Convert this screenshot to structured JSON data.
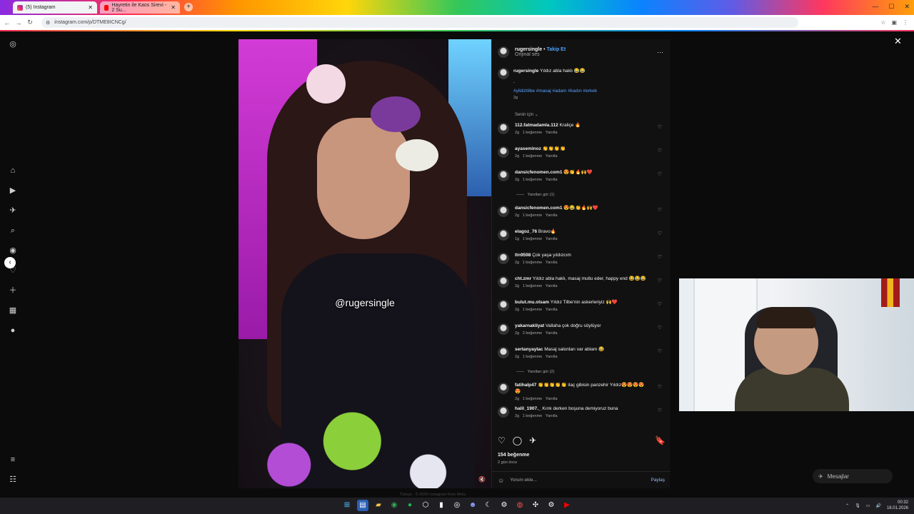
{
  "browser": {
    "tabs": [
      {
        "title": "(5) Instagram",
        "active": true
      },
      {
        "title": "Hayretin ile Kaos Sirevi - 2 Su...",
        "active": false
      }
    ],
    "url": "instagram.com/p/DTME8ICNCg/"
  },
  "post": {
    "watermark": "@rugersingle",
    "author": "rugersingle",
    "follow_label": "Takip Et",
    "audio": "Orijinal ses",
    "caption_user": "rugersingle",
    "caption_text": "Yıldız abla haklı 😂😂",
    "caption_dot": ".",
    "hashtags": "#yildiztilbe #masaj #adam #kadın #erkek",
    "caption_age": "2g",
    "for_you": "Senin için",
    "likes": "154 beğenme",
    "time_ago": "2 gün önce",
    "composer_placeholder": "Yorum ekle...",
    "post_button": "Paylaş"
  },
  "comments": [
    {
      "user": "112.fatmadamla.112",
      "text": "Kraliçe 🔥",
      "age": "2g",
      "likes": "1 beğenme",
      "reply": "Yanıtla"
    },
    {
      "user": "ayaseminoz",
      "text": "👏👏👏👏",
      "age": "2g",
      "likes": "1 beğenme",
      "reply": "Yanıtla"
    },
    {
      "user": "dansicfenomen.com1",
      "text": "😍👏🔥🙌❤️",
      "age": "2g",
      "likes": "1 beğenme",
      "reply": "Yanıtla",
      "view_replies": "Yanıtları gör (1)"
    },
    {
      "user": "dansicfenomen.com1",
      "text": "😍😂👏🔥🙌❤️",
      "age": "2g",
      "likes": "1 beğenme",
      "reply": "Yanıtla"
    },
    {
      "user": "elagoz_76",
      "text": "Bravo🔥",
      "age": "1g",
      "likes": "1 beğenme",
      "reply": "Yanıtla"
    },
    {
      "user": "tln9598",
      "text": "Çok yaşa yıldızcım",
      "age": "2g",
      "likes": "1 beğenme",
      "reply": "Yanıtla"
    },
    {
      "user": "cht.zmr",
      "text": "Yıldız abla haklı, masaj mutlu eder, happy end 😂😂😂",
      "age": "2g",
      "likes": "1 beğenme",
      "reply": "Yanıtla"
    },
    {
      "user": "bulut.mu.olsam",
      "text": "Yıldız Tilbe'nin askerleriyiz 🙌❤️",
      "age": "2g",
      "likes": "1 beğenme",
      "reply": "Yanıtla"
    },
    {
      "user": "yakarnakliyat",
      "text": "Vallaha çok doğru söylüyor",
      "age": "2g",
      "likes": "2 beğenme",
      "reply": "Yanıtla"
    },
    {
      "user": "sertanyaylac",
      "text": "Masaj salonları var ablam 😂",
      "age": "2g",
      "likes": "1 beğenme",
      "reply": "Yanıtla",
      "view_replies": "Yanıtları gör (2)"
    },
    {
      "user": "fatihalp47",
      "text": "👏👏👏👏👏 ilaç gibisin panzehir Yıldız😍😍😍😍😍",
      "age": "2g",
      "likes": "1 beğenme",
      "reply": "Yanıtla"
    },
    {
      "user": "halil_1907._",
      "text": "Kırık derken boşuna demiyoruz buna",
      "age": "2g",
      "likes": "1 beğenme",
      "reply": "Yanıtla"
    }
  ],
  "overlay": {
    "messages_label": "Mesajlar",
    "footer": "Türkçe · © 2026 Instagram from Meta"
  },
  "taskbar": {
    "time": "00:32",
    "date": "18.01.2026"
  },
  "colors": {
    "accent_link": "#4ea3ff",
    "background": "#0b0b0b"
  }
}
